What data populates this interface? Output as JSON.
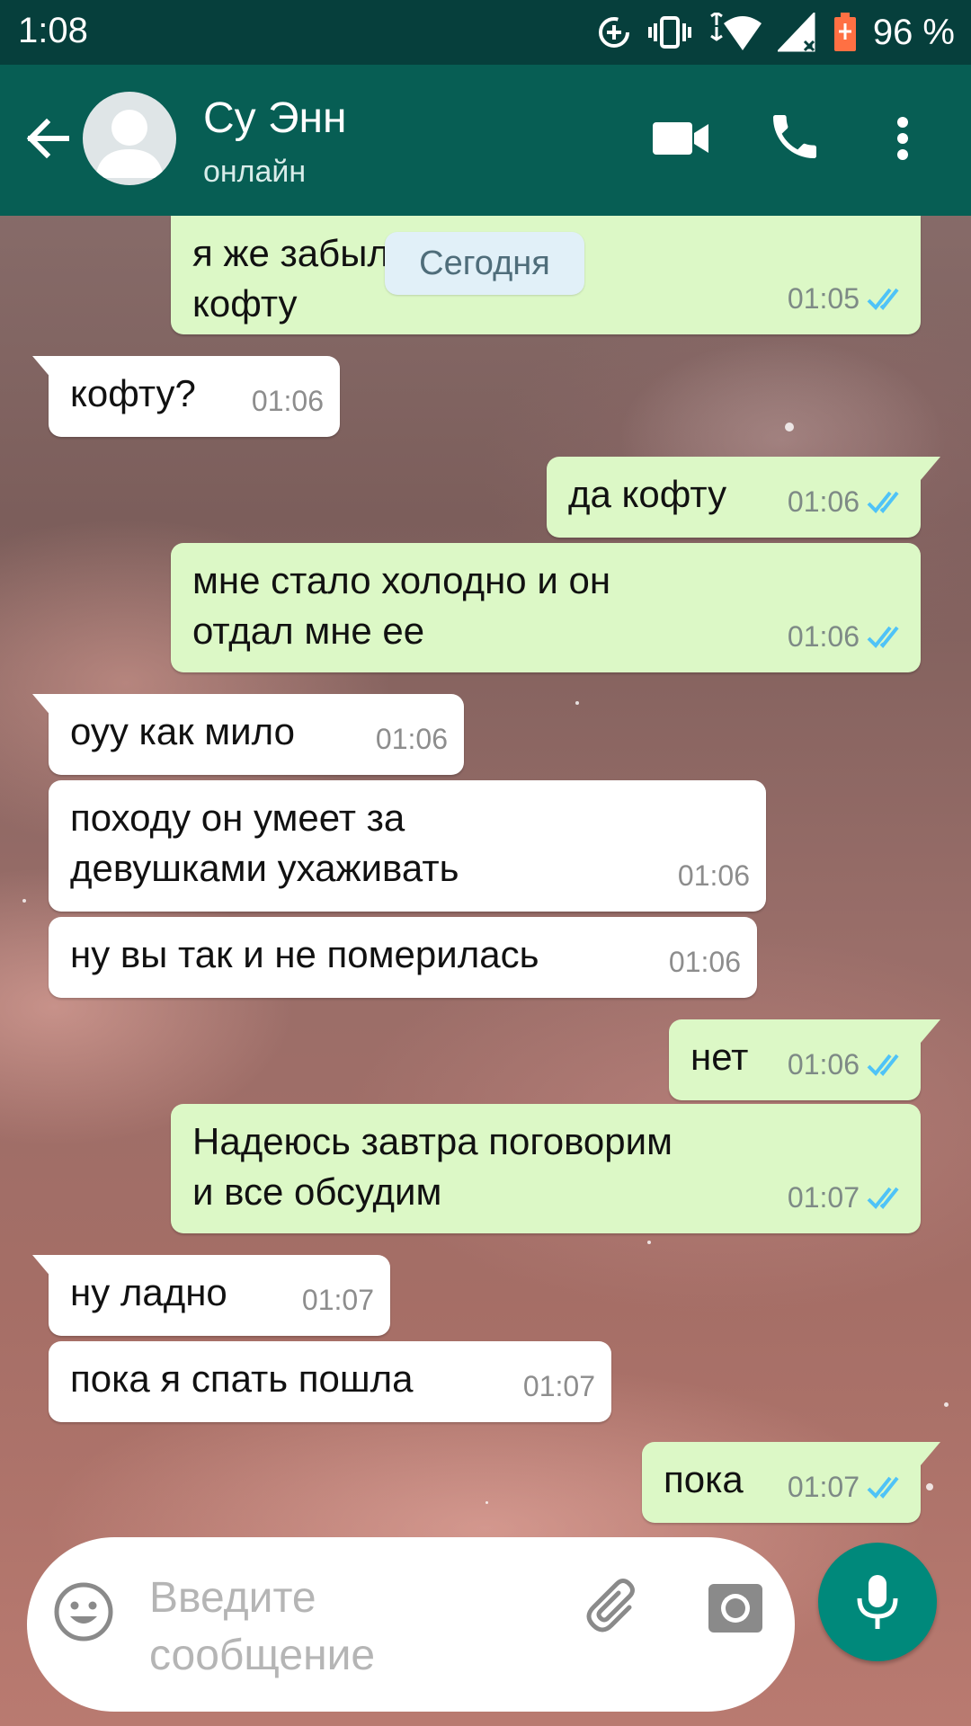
{
  "status_bar": {
    "time": "1:08",
    "battery": "96 %"
  },
  "header": {
    "contact_name": "Су Энн",
    "contact_status": "онлайн"
  },
  "date_chip": "Сегодня",
  "messages": [
    {
      "dir": "out",
      "text": "я же забыл отдать его\nкофту",
      "time": "01:05",
      "read": true
    },
    {
      "dir": "in",
      "text": "кофту?",
      "time": "01:06"
    },
    {
      "dir": "out",
      "text": "да кофту",
      "time": "01:06",
      "read": true
    },
    {
      "dir": "out",
      "text": "мне стало холодно и он\nотдал мне ее",
      "time": "01:06",
      "read": true
    },
    {
      "dir": "in",
      "text": "оуу как мило",
      "time": "01:06"
    },
    {
      "dir": "in",
      "text": "походу он умеет за\nдевушками ухаживать",
      "time": "01:06"
    },
    {
      "dir": "in",
      "text": "ну вы так и не померилась",
      "time": "01:06"
    },
    {
      "dir": "out",
      "text": "нет",
      "time": "01:06",
      "read": true
    },
    {
      "dir": "out",
      "text": "Надеюсь завтра поговорим\nи все обсудим",
      "time": "01:07",
      "read": true
    },
    {
      "dir": "in",
      "text": "ну ладно",
      "time": "01:07"
    },
    {
      "dir": "in",
      "text": "пока я спать пошла",
      "time": "01:07"
    },
    {
      "dir": "out",
      "text": "пока",
      "time": "01:07",
      "read": true
    }
  ],
  "composer": {
    "placeholder": "Введите сообщение"
  },
  "icons": {
    "back": "arrow-back-icon",
    "video": "video-call-icon",
    "call": "phone-icon",
    "menu": "more-vert-icon",
    "emoji": "emoji-icon",
    "attach": "paperclip-icon",
    "camera": "camera-icon",
    "mic": "microphone-icon"
  },
  "colors": {
    "header": "#075e54",
    "status_bar": "#063f3c",
    "outgoing_bubble": "#dcf8c6",
    "incoming_bubble": "#ffffff",
    "read_tick": "#4fc3f7",
    "mic_button": "#00897b"
  }
}
